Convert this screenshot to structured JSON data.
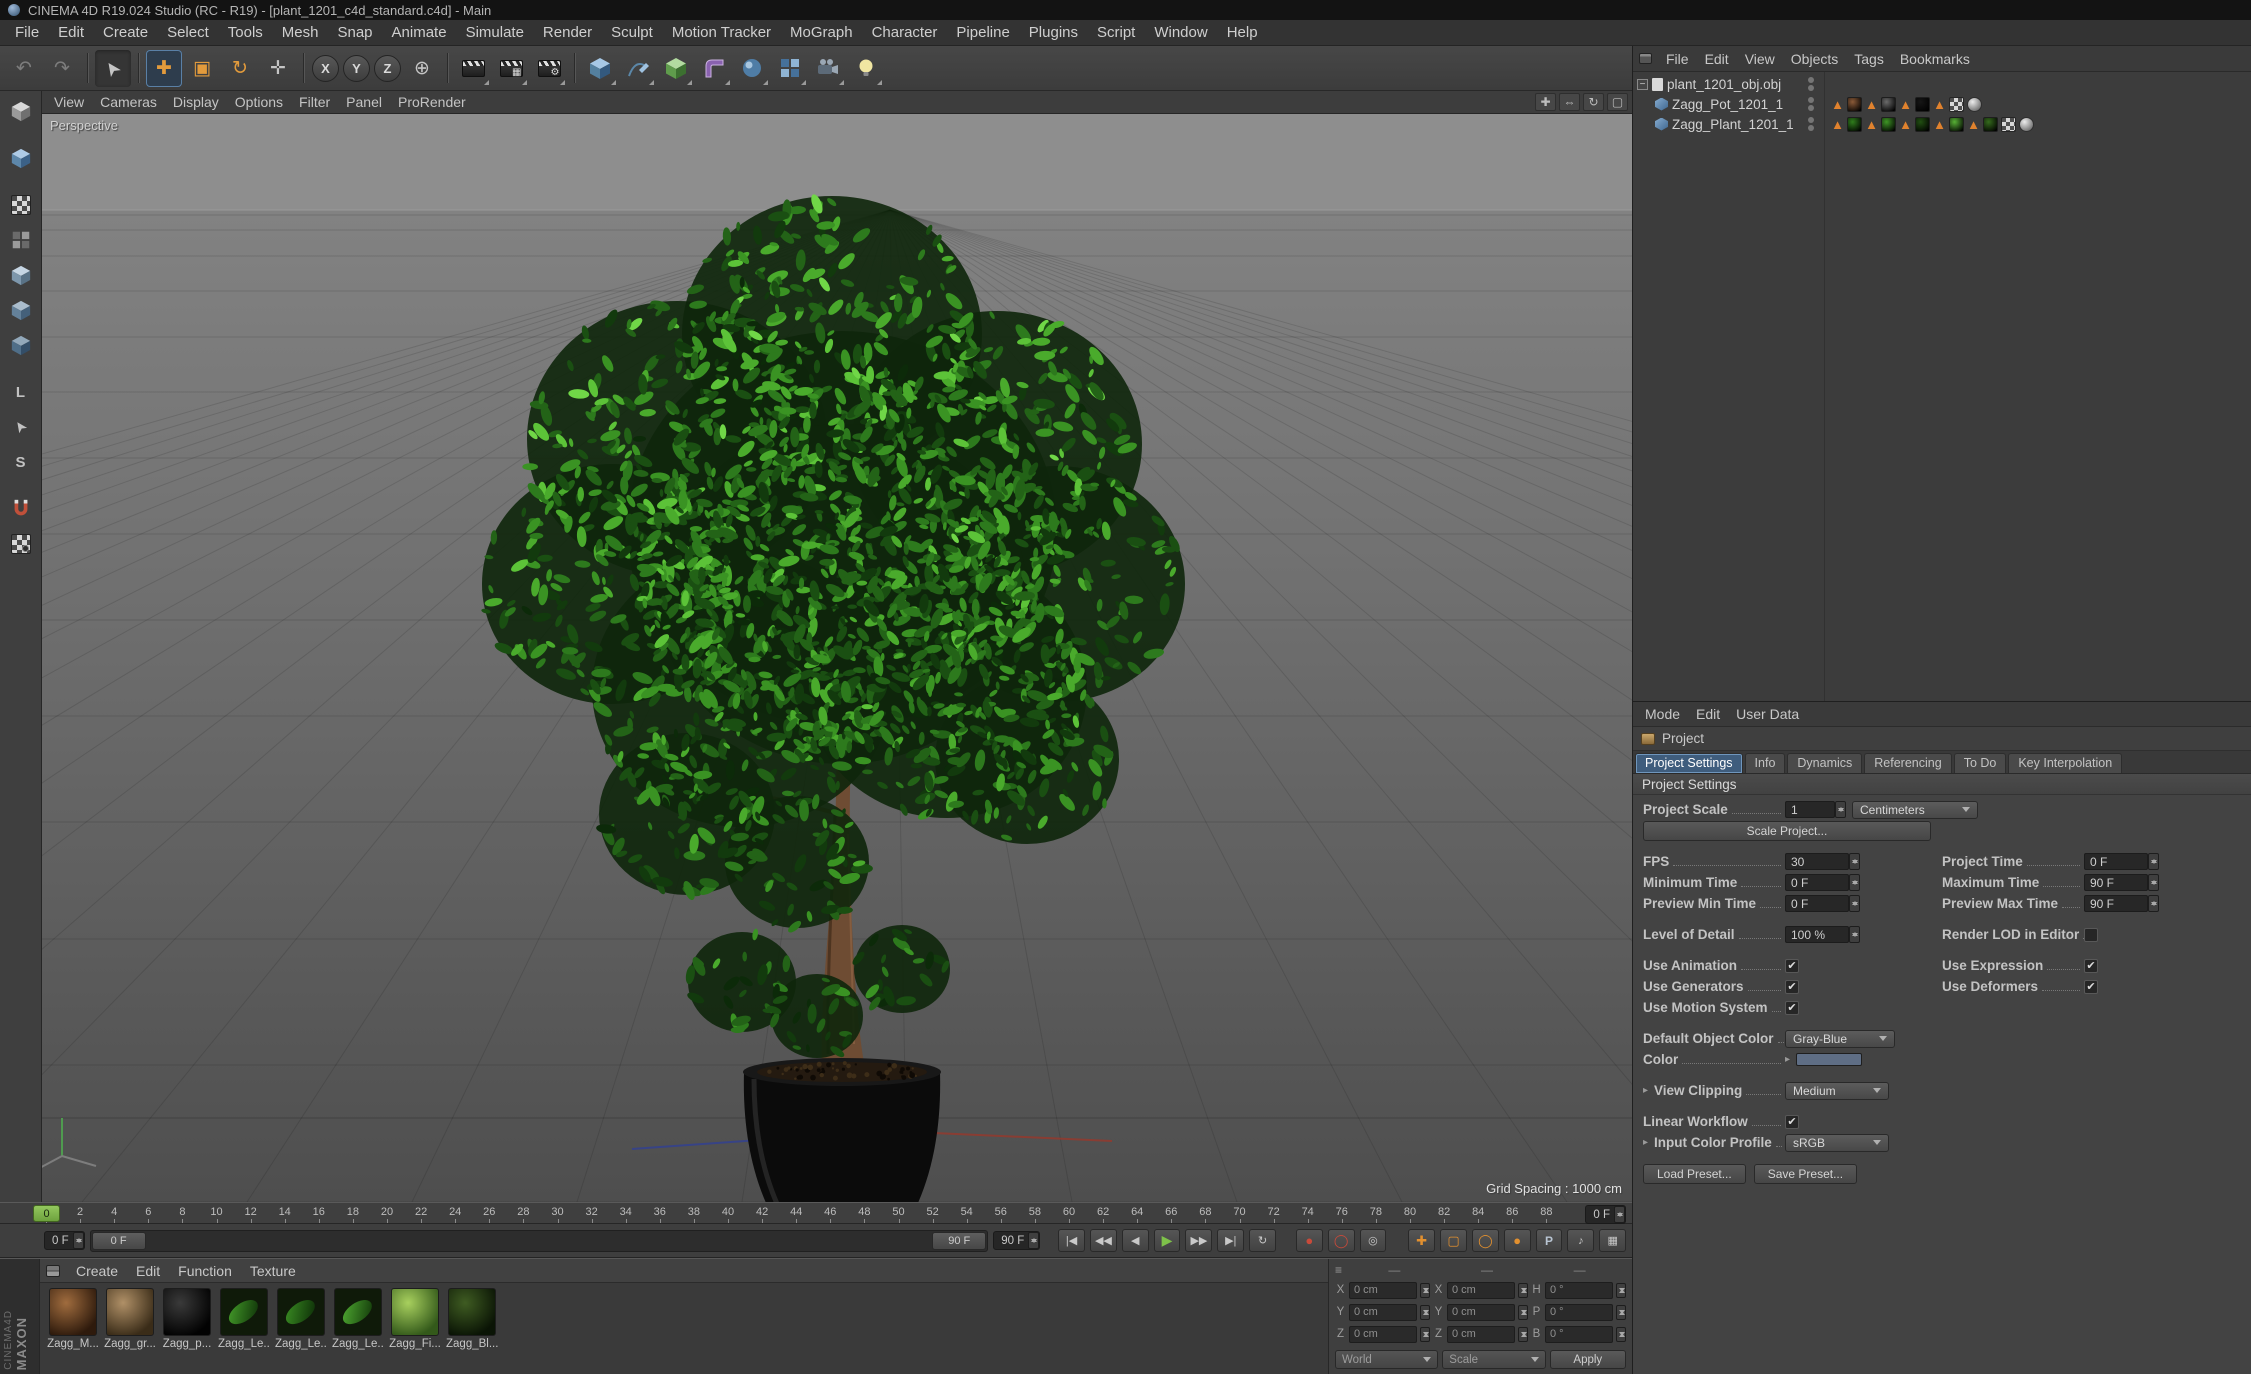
{
  "titlebar": {
    "title": "CINEMA 4D R19.024 Studio (RC - R19) - [plant_1201_c4d_standard.c4d] - Main"
  },
  "menubar": {
    "items": [
      "File",
      "Edit",
      "Create",
      "Select",
      "Tools",
      "Mesh",
      "Snap",
      "Animate",
      "Simulate",
      "Render",
      "Sculpt",
      "Motion Tracker",
      "MoGraph",
      "Character",
      "Pipeline",
      "Plugins",
      "Script",
      "Window",
      "Help"
    ]
  },
  "toolbar": {
    "axis_x": "X",
    "axis_y": "Y",
    "axis_z": "Z"
  },
  "viewport": {
    "menus": [
      "View",
      "Cameras",
      "Display",
      "Options",
      "Filter",
      "Panel",
      "ProRender"
    ],
    "view_label": "Perspective",
    "grid_spacing_label": "Grid Spacing : 1000 cm"
  },
  "timeline": {
    "ruler": {
      "start": 0,
      "end": 88,
      "step": 2
    },
    "playhead_label": "0",
    "ruler_field": "0 F",
    "current_frame": "0 F",
    "range_start": "0 F",
    "range_end": "90 F",
    "range_end_value": "90 F"
  },
  "materials": {
    "menus": [
      "Create",
      "Edit",
      "Function",
      "Texture"
    ],
    "items": [
      {
        "label": "Zagg_M...",
        "kind": "sphere",
        "c1": "#a06c3e",
        "c2": "#2e1a0c"
      },
      {
        "label": "Zagg_gr...",
        "kind": "sphere",
        "c1": "#b09067",
        "c2": "#3a2c18"
      },
      {
        "label": "Zagg_p...",
        "kind": "sphere",
        "c1": "#3a3a3a",
        "c2": "#020202"
      },
      {
        "label": "Zagg_Le...",
        "kind": "leaf",
        "c1": "#46a02b",
        "c2": "#0d2f07"
      },
      {
        "label": "Zagg_Le...",
        "kind": "leaf",
        "c1": "#3c9124",
        "c2": "#0b2a06"
      },
      {
        "label": "Zagg_Le...",
        "kind": "leaf",
        "c1": "#51ad33",
        "c2": "#103508"
      },
      {
        "label": "Zagg_Fi...",
        "kind": "sphere",
        "c1": "#a8d05e",
        "c2": "#33591a"
      },
      {
        "label": "Zagg_Bl...",
        "kind": "sphere",
        "c1": "#3f5c22",
        "c2": "#0a1405"
      }
    ]
  },
  "coordinates": {
    "headers": [
      "—",
      "—",
      "—"
    ],
    "rows": [
      {
        "l1": "X",
        "v1": "0 cm",
        "l2": "X",
        "v2": "0 cm",
        "l3": "H",
        "v3": "0 °"
      },
      {
        "l1": "Y",
        "v1": "0 cm",
        "l2": "Y",
        "v2": "0 cm",
        "l3": "P",
        "v3": "0 °"
      },
      {
        "l1": "Z",
        "v1": "0 cm",
        "l2": "Z",
        "v2": "0 cm",
        "l3": "B",
        "v3": "0 °"
      }
    ],
    "dropdown1": "World",
    "dropdown2": "Scale",
    "apply_button": "Apply"
  },
  "object_manager": {
    "menus": [
      "File",
      "Edit",
      "View",
      "Objects",
      "Tags",
      "Bookmarks"
    ],
    "rows": [
      {
        "name": "plant_1201_obj.obj",
        "indent": 0,
        "icon": "file",
        "tags": []
      },
      {
        "name": "Zagg_Pot_1201_1",
        "indent": 1,
        "icon": "mesh",
        "tags": [
          "tri",
          "#8a5a38",
          "tri",
          "#6b6b6b",
          "tri",
          "#161616",
          "tri",
          "uvw",
          "phong"
        ]
      },
      {
        "name": "Zagg_Plant_1201_1",
        "indent": 1,
        "icon": "mesh",
        "tags": [
          "tri",
          "#2f7d1c",
          "tri",
          "#3f9626",
          "tri",
          "#214f12",
          "tri",
          "#57b135",
          "tri",
          "#356b1d",
          "uvw",
          "phong"
        ]
      }
    ]
  },
  "attributes": {
    "menus": [
      "Mode",
      "Edit",
      "User Data"
    ],
    "panel_title": "Project",
    "tabs": [
      "Project Settings",
      "Info",
      "Dynamics",
      "Referencing",
      "To Do",
      "Key Interpolation"
    ],
    "active_tab_index": 0,
    "section_title": "Project Settings",
    "project_scale_label": "Project Scale",
    "project_scale_value": "1",
    "project_scale_unit": "Centimeters",
    "scale_project_button": "Scale Project...",
    "fps_label": "FPS",
    "fps_value": "30",
    "project_time_label": "Project Time",
    "project_time_value": "0 F",
    "minimum_time_label": "Minimum Time",
    "minimum_time_value": "0 F",
    "maximum_time_label": "Maximum Time",
    "maximum_time_value": "90 F",
    "preview_min_label": "Preview Min Time",
    "preview_min_value": "0 F",
    "preview_max_label": "Preview Max Time",
    "preview_max_value": "90 F",
    "lod_label": "Level of Detail",
    "lod_value": "100 %",
    "render_lod_label": "Render LOD in Editor",
    "use_animation_label": "Use Animation",
    "use_expression_label": "Use Expression",
    "use_generators_label": "Use Generators",
    "use_deformers_label": "Use Deformers",
    "use_motion_label": "Use Motion System",
    "default_color_label": "Default Object Color",
    "default_color_value": "Gray-Blue",
    "color_label": "Color",
    "view_clipping_label": "View Clipping",
    "view_clipping_value": "Medium",
    "linear_workflow_label": "Linear Workflow",
    "input_profile_label": "Input Color Profile",
    "input_profile_value": "sRGB",
    "load_preset_button": "Load Preset...",
    "save_preset_button": "Save Preset..."
  },
  "branding": {
    "line1": "MAXON",
    "line2": "CINEMA4D"
  }
}
